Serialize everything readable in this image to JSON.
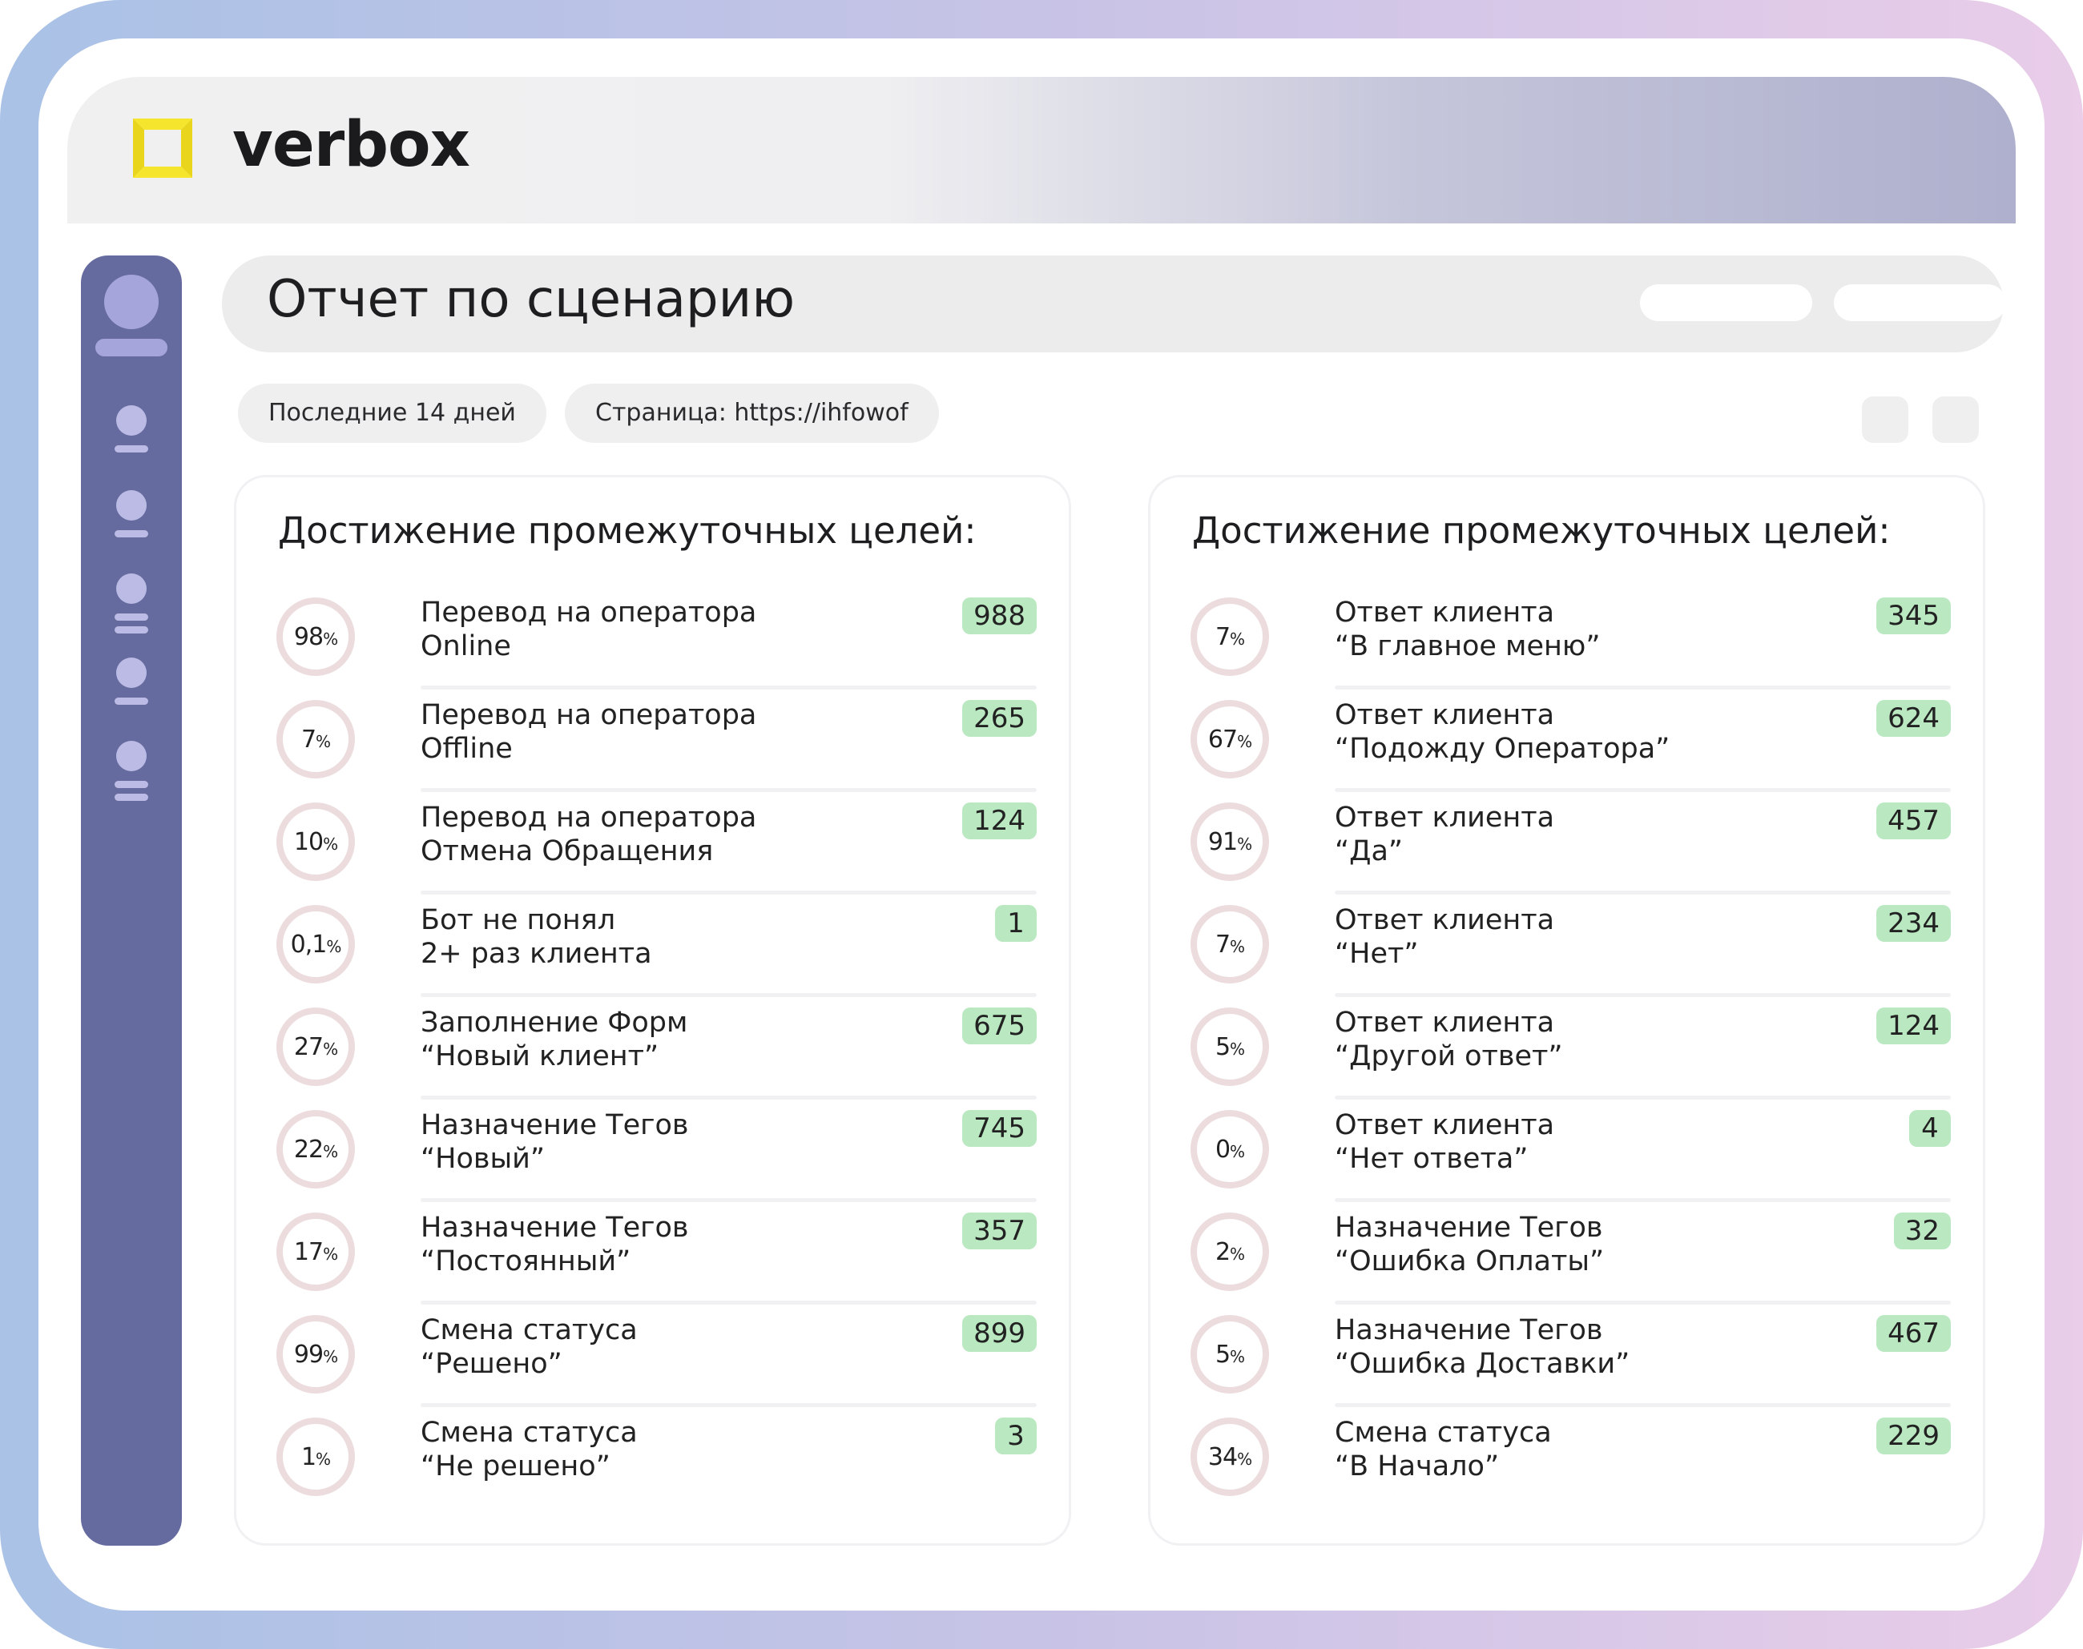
{
  "brand": {
    "name": "verbox",
    "accent": "#f5e52d"
  },
  "sidebar": {
    "bg": "#656b9f"
  },
  "header": {
    "title": "Отчет по сценарию"
  },
  "filters": [
    {
      "label": "Последние 14 дней"
    },
    {
      "label": "Страница: https://ihfowof"
    }
  ],
  "panels": [
    {
      "title": "Достижение промежуточных целей:",
      "rows": [
        {
          "pct": "98",
          "line1": "Перевод на оператора",
          "line2": "Online",
          "count": "988"
        },
        {
          "pct": "7",
          "line1": "Перевод на оператора",
          "line2": "Offline",
          "count": "265"
        },
        {
          "pct": "10",
          "line1": "Перевод на оператора",
          "line2": "Отмена Обращения",
          "count": "124"
        },
        {
          "pct": "0,1",
          "line1": "Бот не понял",
          "line2": "2+ раз клиента",
          "count": "1"
        },
        {
          "pct": "27",
          "line1": "Заполнение Форм",
          "line2": "“Новый клиент”",
          "count": "675"
        },
        {
          "pct": "22",
          "line1": "Назначение Тегов",
          "line2": "“Новый”",
          "count": "745"
        },
        {
          "pct": "17",
          "line1": "Назначение Тегов",
          "line2": "“Постоянный”",
          "count": "357"
        },
        {
          "pct": "99",
          "line1": "Смена статуса",
          "line2": "“Решено”",
          "count": "899"
        },
        {
          "pct": "1",
          "line1": "Смена статуса",
          "line2": "“Не решено”",
          "count": "3"
        }
      ]
    },
    {
      "title": "Достижение промежуточных целей:",
      "rows": [
        {
          "pct": "7",
          "line1": "Ответ клиента",
          "line2": "“В главное меню”",
          "count": "345"
        },
        {
          "pct": "67",
          "line1": "Ответ клиента",
          "line2": "“Подожду Оператора”",
          "count": "624"
        },
        {
          "pct": "91",
          "line1": "Ответ клиента",
          "line2": "“Да”",
          "count": "457"
        },
        {
          "pct": "7",
          "line1": "Ответ клиента",
          "line2": "“Нет”",
          "count": "234"
        },
        {
          "pct": "5",
          "line1": "Ответ клиента",
          "line2": "“Другой ответ”",
          "count": "124"
        },
        {
          "pct": "0",
          "line1": "Ответ клиента",
          "line2": "“Нет ответа”",
          "count": "4"
        },
        {
          "pct": "2",
          "line1": "Назначение Тегов",
          "line2": "“Ошибка Оплаты”",
          "count": "32"
        },
        {
          "pct": "5",
          "line1": "Назначение Тегов",
          "line2": "“Ошибка Доставки”",
          "count": "467"
        },
        {
          "pct": "34",
          "line1": "Смена статуса",
          "line2": "“В Начало”",
          "count": "229"
        }
      ]
    }
  ],
  "units": {
    "percent_sign": "%"
  }
}
